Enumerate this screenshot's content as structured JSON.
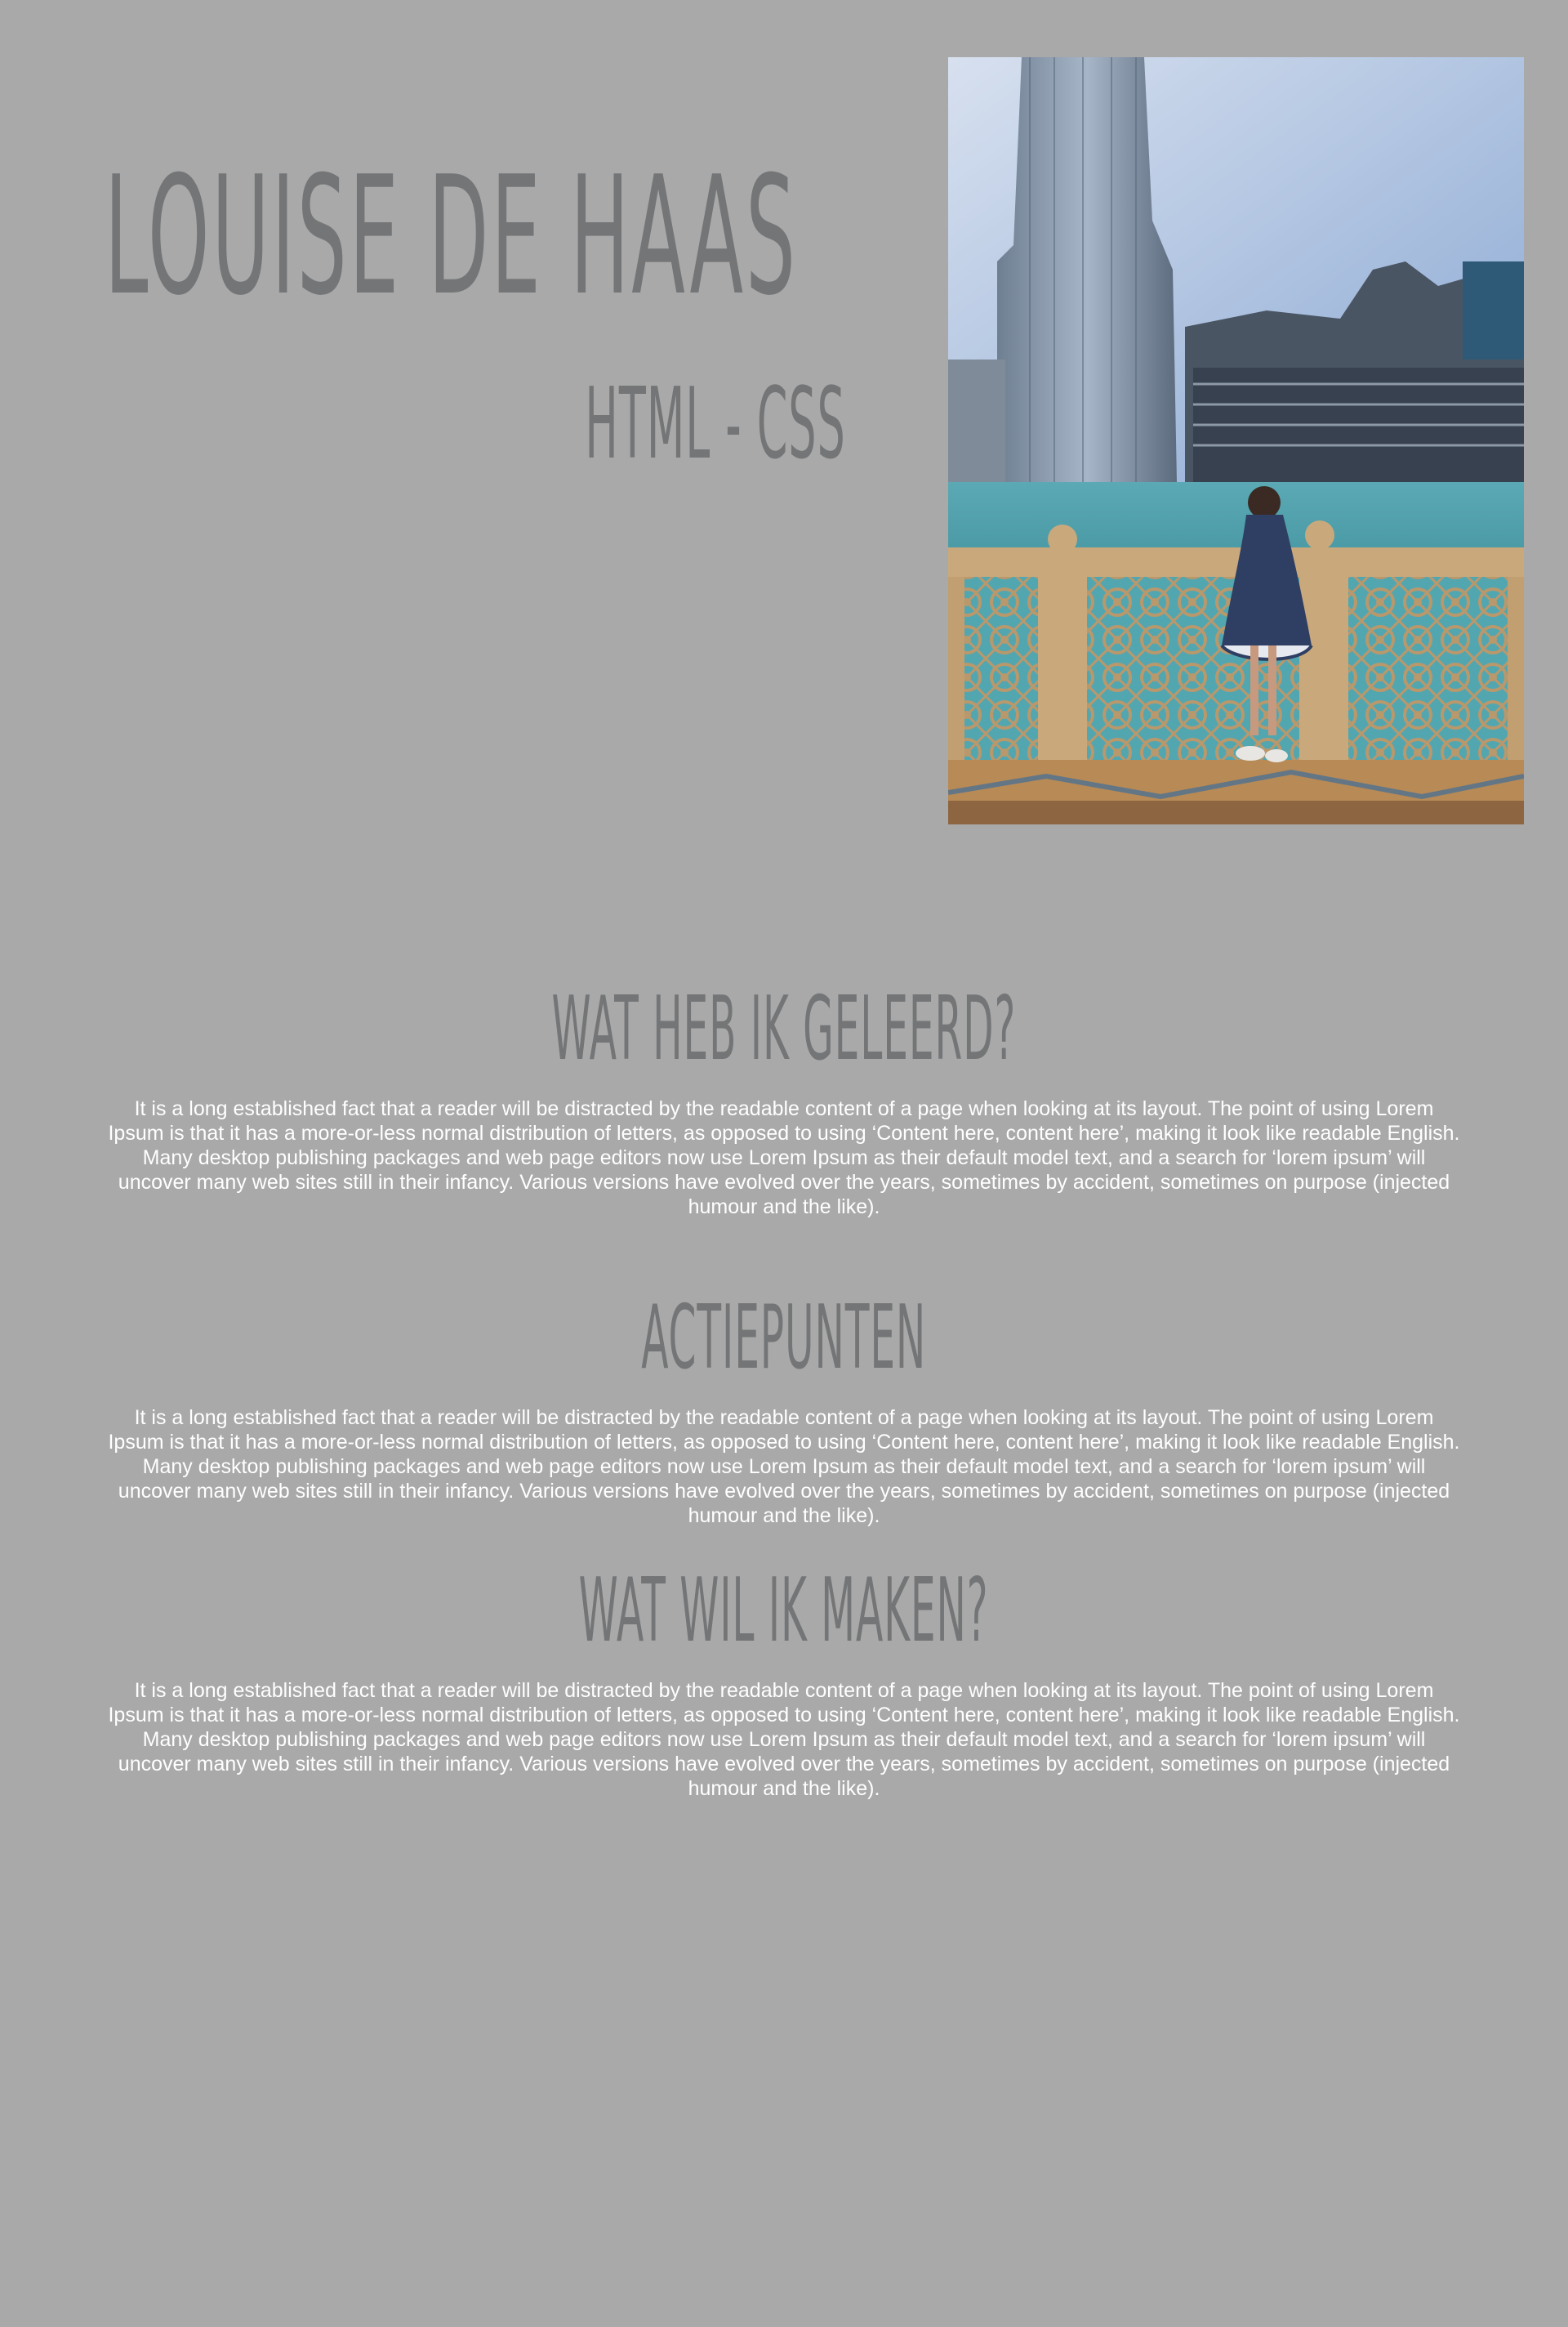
{
  "header": {
    "name": "Louise de Haas",
    "subtitle": "HTML - CSS"
  },
  "photo": {
    "alt": "Louise de Haas"
  },
  "sections": [
    {
      "title": "Wat heb ik geleerd?",
      "body": "It is a long established fact that a reader will be distracted by the readable content of a page when looking at its layout. The point of using Lorem Ipsum is that it has a more-or-less normal distribution of letters, as opposed to using ‘Content here, content here’, making it look like readable English. Many desktop publishing packages and web page editors now use Lorem Ipsum as their default model text, and a search for ‘lorem ipsum’ will uncover many web sites still in their infancy. Various versions have evolved over the years, sometimes by accident, sometimes on purpose (injected humour and the like)."
    },
    {
      "title": "Actiepunten",
      "body": "It is a long established fact that a reader will be distracted by the readable content of a page when looking at its layout. The point of using Lorem Ipsum is that it has a more-or-less normal distribution of letters, as opposed to using ‘Content here, content here’, making it look like readable English. Many desktop publishing packages and web page editors now use Lorem Ipsum as their default model text, and a search for ‘lorem ipsum’ will uncover many web sites still in their infancy. Various versions have evolved over the years, sometimes by accident, sometimes on purpose (injected humour and the like)."
    },
    {
      "title": "Wat wil ik maken?",
      "body": "It is a long established fact that a reader will be distracted by the readable content of a page when looking at its layout. The point of using Lorem Ipsum is that it has a more-or-less normal distribution of letters, as opposed to using ‘Content here, content here’, making it look like readable English. Many desktop publishing packages and web page editors now use Lorem Ipsum as their default model text, and a search for ‘lorem ipsum’ will uncover many web sites still in their infancy. Various versions have evolved over the years, sometimes by accident, sometimes on purpose (injected humour and the like)."
    }
  ],
  "colors": {
    "background": "#a9a9a9",
    "heading": "#737577",
    "body_text": "#ffffff"
  }
}
